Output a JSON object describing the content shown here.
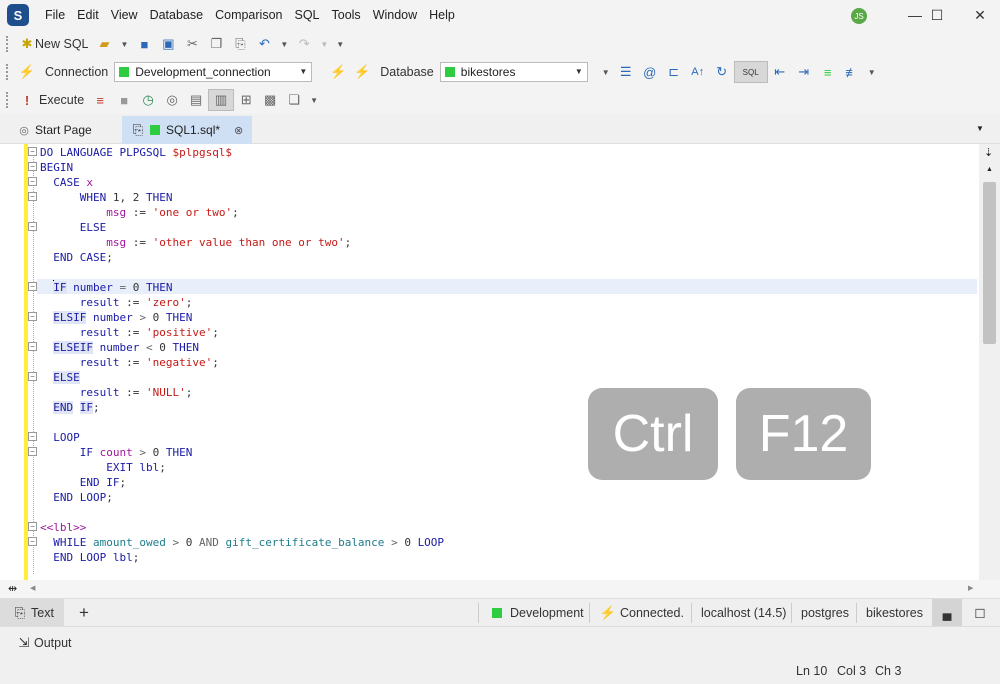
{
  "app": {
    "logo": "S",
    "user_initials": "JS"
  },
  "menu": [
    "File",
    "Edit",
    "View",
    "Database",
    "Comparison",
    "SQL",
    "Tools",
    "Window",
    "Help"
  ],
  "toolbar1": {
    "new_sql": "New SQL"
  },
  "toolbar2": {
    "connection_label": "Connection",
    "connection_value": "Development_connection",
    "database_label": "Database",
    "database_value": "bikestores",
    "sql_button": "SQL"
  },
  "toolbar3": {
    "execute": "Execute"
  },
  "tabs": {
    "start_page": "Start Page",
    "sql_file": "SQL1.sql*"
  },
  "code": [
    "DO LANGUAGE PLPGSQL $plpgsql$",
    "BEGIN",
    "CASE x",
    "WHEN 1, 2 THEN",
    "msg := 'one or two';",
    "ELSE",
    "msg := 'other value than one or two';",
    "END CASE;",
    "",
    "IF number = 0 THEN",
    "result := 'zero';",
    "ELSIF number > 0 THEN",
    "result := 'positive';",
    "ELSEIF number < 0 THEN",
    "result := 'negative';",
    "ELSE",
    "result := 'NULL';",
    "END IF;",
    "",
    "LOOP",
    "IF count > 0 THEN",
    "EXIT lbl;",
    "END IF;",
    "END LOOP;",
    "",
    "<<lbl>>",
    "WHILE amount_owed > 0 AND gift_certificate_balance > 0 LOOP",
    "END LOOP lbl;"
  ],
  "keys": [
    "Ctrl",
    "F12"
  ],
  "status": {
    "text_tab": "Text",
    "add": "+",
    "environment": "Development",
    "connected": "Connected.",
    "host": "localhost (14.5)",
    "user": "postgres",
    "database": "bikestores"
  },
  "output": {
    "label": "Output"
  },
  "position": {
    "ln": "Ln 10",
    "col": "Col 3",
    "ch": "Ch 3"
  },
  "colors": {
    "accent": "#2a6ab8",
    "gutter_yellow": "#ffef3c",
    "env_green": "#2ecc40"
  }
}
